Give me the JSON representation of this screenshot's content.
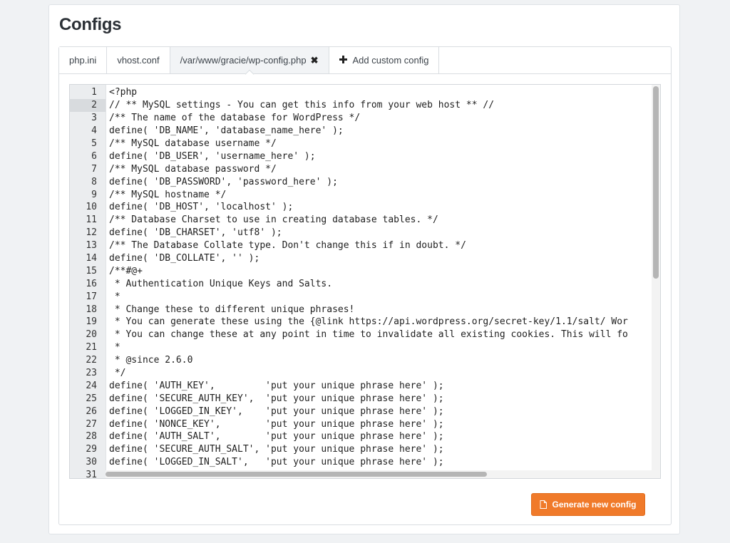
{
  "card": {
    "title": "Configs"
  },
  "tabs": [
    {
      "label": "php.ini",
      "active": false
    },
    {
      "label": "vhost.conf",
      "active": false
    },
    {
      "label": "/var/www/gracie/wp-config.php",
      "active": true,
      "close_icon": "✖"
    },
    {
      "label": "Add custom config",
      "icon": "plus-icon"
    }
  ],
  "editor": {
    "current_line": 2,
    "lines": [
      "<?php",
      "// ** MySQL settings - You can get this info from your web host ** //",
      "/** The name of the database for WordPress */",
      "define( 'DB_NAME', 'database_name_here' );",
      "/** MySQL database username */",
      "define( 'DB_USER', 'username_here' );",
      "/** MySQL database password */",
      "define( 'DB_PASSWORD', 'password_here' );",
      "/** MySQL hostname */",
      "define( 'DB_HOST', 'localhost' );",
      "/** Database Charset to use in creating database tables. */",
      "define( 'DB_CHARSET', 'utf8' );",
      "/** The Database Collate type. Don't change this if in doubt. */",
      "define( 'DB_COLLATE', '' );",
      "/**#@+",
      " * Authentication Unique Keys and Salts.",
      " *",
      " * Change these to different unique phrases!",
      " * You can generate these using the {@link https://api.wordpress.org/secret-key/1.1/salt/ Wor",
      " * You can change these at any point in time to invalidate all existing cookies. This will fo",
      " *",
      " * @since 2.6.0",
      " */",
      "define( 'AUTH_KEY',         'put your unique phrase here' );",
      "define( 'SECURE_AUTH_KEY',  'put your unique phrase here' );",
      "define( 'LOGGED_IN_KEY',    'put your unique phrase here' );",
      "define( 'NONCE_KEY',        'put your unique phrase here' );",
      "define( 'AUTH_SALT',        'put your unique phrase here' );",
      "define( 'SECURE_AUTH_SALT', 'put your unique phrase here' );",
      "define( 'LOGGED_IN_SALT',   'put your unique phrase here' );",
      ""
    ]
  },
  "actions": {
    "generate_label": "Generate new config",
    "generate_icon": "file-icon"
  },
  "colors": {
    "accent": "#f07a2a",
    "background": "#f0f2f4"
  }
}
